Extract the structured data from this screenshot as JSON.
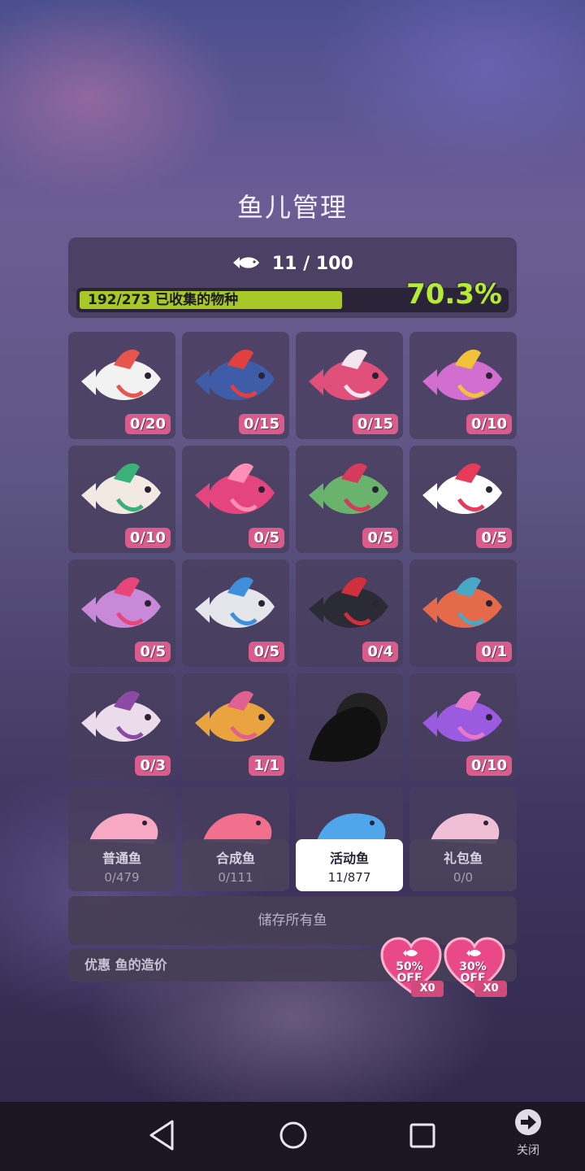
{
  "title": "鱼儿管理",
  "progress": {
    "count_text": "11 / 100",
    "species_text": "192/273 已收集的物种",
    "percent_text": "70.3%",
    "fill_fraction": 0.703
  },
  "fish_cells": [
    {
      "count": "0/20",
      "color": "#f2f2f2",
      "accent": "#e8544e"
    },
    {
      "count": "0/15",
      "color": "#3f5ca8",
      "accent": "#e0403e"
    },
    {
      "count": "0/15",
      "color": "#e0507a",
      "accent": "#f3e6ee"
    },
    {
      "count": "0/10",
      "color": "#d16ed0",
      "accent": "#f2c23b"
    },
    {
      "count": "0/10",
      "color": "#f3e9e3",
      "accent": "#39b178"
    },
    {
      "count": "0/5",
      "color": "#e5457f",
      "accent": "#ff8fb5"
    },
    {
      "count": "0/5",
      "color": "#6ab36d",
      "accent": "#d63a5c"
    },
    {
      "count": "0/5",
      "color": "#ffffff",
      "accent": "#e83a5a"
    },
    {
      "count": "0/5",
      "color": "#c88ad8",
      "accent": "#e8457a"
    },
    {
      "count": "0/5",
      "color": "#e5e5ec",
      "accent": "#3e8fdc"
    },
    {
      "count": "0/4",
      "color": "#2b2b35",
      "accent": "#d0303c"
    },
    {
      "count": "0/1",
      "color": "#e46a4a",
      "accent": "#49a8c6"
    },
    {
      "count": "0/3",
      "color": "#eadcea",
      "accent": "#8b4aa3"
    },
    {
      "count": "1/1",
      "color": "#e9a440",
      "accent": "#e0608f"
    },
    {
      "count": "",
      "color": "#111111",
      "accent": "#222222"
    },
    {
      "count": "0/10",
      "color": "#9b5be0",
      "accent": "#e979c7"
    }
  ],
  "partial_cells": [
    {
      "color": "#f7a9c3"
    },
    {
      "color": "#f26f8d"
    },
    {
      "color": "#4fa6ea"
    },
    {
      "color": "#f1bfd5"
    }
  ],
  "tabs": [
    {
      "label": "普通鱼",
      "count": "0/479",
      "active": false
    },
    {
      "label": "合成鱼",
      "count": "0/111",
      "active": false
    },
    {
      "label": "活动鱼",
      "count": "11/877",
      "active": true
    },
    {
      "label": "礼包鱼",
      "count": "0/0",
      "active": false
    }
  ],
  "store_label": "储存所有鱼",
  "discount_label": "优惠 鱼的造价",
  "coupons": [
    {
      "pct": "50%",
      "off": "OFF",
      "mult": "X0"
    },
    {
      "pct": "30%",
      "off": "OFF",
      "mult": "X0"
    }
  ],
  "nav": {
    "close_label": "关闭"
  },
  "colors": {
    "bar_fill": "#a7c826",
    "percent": "#b6ea33",
    "badge": "#d95c8d",
    "coupon": "#e94a87"
  }
}
